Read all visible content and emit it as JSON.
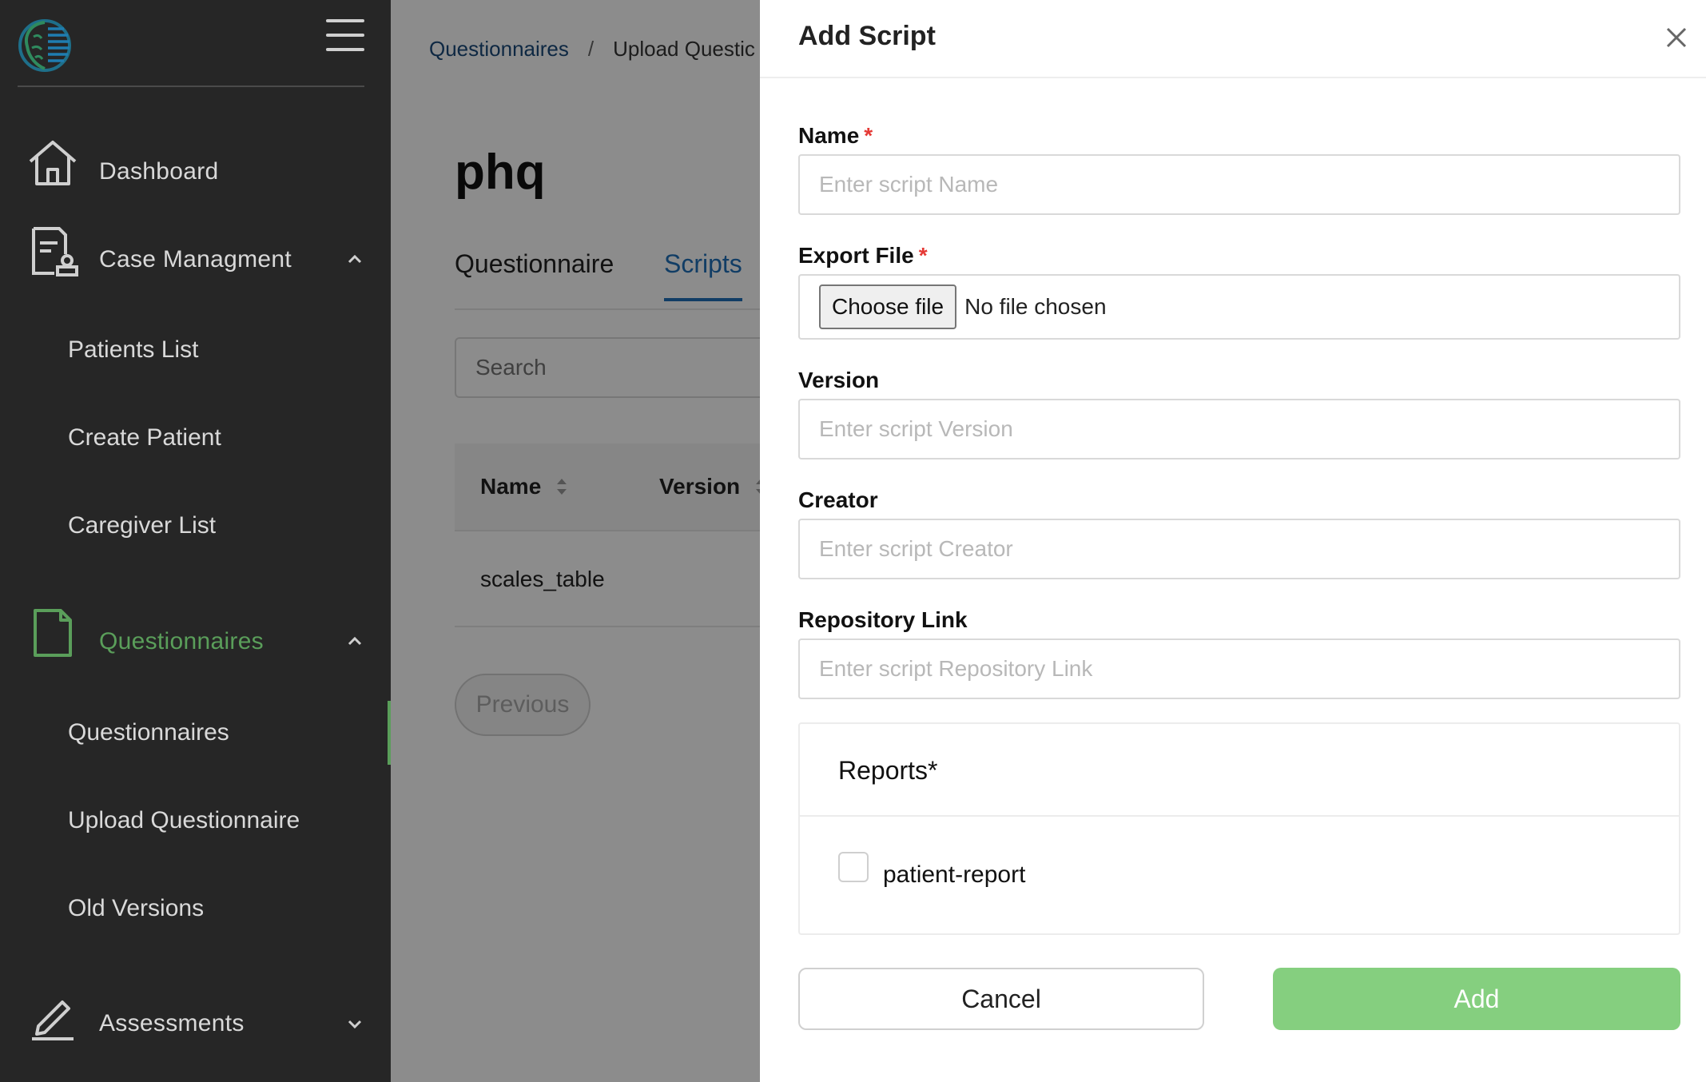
{
  "sidebar": {
    "nav": [
      {
        "label": "Dashboard",
        "icon": "home-icon"
      },
      {
        "label": "Case Managment",
        "icon": "case-document-icon"
      },
      {
        "label": "Questionnaires",
        "icon": "file-icon"
      },
      {
        "label": "Assessments",
        "icon": "pen-icon"
      }
    ],
    "case_sub": [
      {
        "label": "Patients List"
      },
      {
        "label": "Create Patient"
      },
      {
        "label": "Caregiver List"
      }
    ],
    "questionnaire_sub": [
      {
        "label": "Questionnaires"
      },
      {
        "label": "Upload Questionnaire"
      },
      {
        "label": "Old Versions"
      }
    ],
    "active_color": "#5a9e5a"
  },
  "main": {
    "breadcrumb": [
      "Questionnaires",
      "/",
      "Upload Questic"
    ],
    "title": "phq",
    "tabs": [
      {
        "label": "Questionnaire"
      },
      {
        "label": "Scripts"
      }
    ],
    "search_placeholder": "Search",
    "table": {
      "columns": [
        "Name",
        "Version"
      ],
      "rows": [
        [
          "scales_table"
        ]
      ]
    },
    "previous_label": "Previous"
  },
  "drawer": {
    "title": "Add Script",
    "fields": {
      "name": {
        "label": "Name",
        "required": "*",
        "placeholder": "Enter script Name"
      },
      "export_file": {
        "label": "Export File",
        "required": "*",
        "button": "Choose file",
        "status": "No file chosen"
      },
      "version": {
        "label": "Version",
        "placeholder": "Enter script Version"
      },
      "creator": {
        "label": "Creator",
        "placeholder": "Enter script Creator"
      },
      "repository": {
        "label": "Repository Link",
        "placeholder": "Enter script Repository Link"
      }
    },
    "reports": {
      "title": "Reports*",
      "items": [
        {
          "label": "patient-report"
        }
      ]
    },
    "cancel_label": "Cancel",
    "add_label": "Add",
    "add_color": "#85cf7f"
  }
}
